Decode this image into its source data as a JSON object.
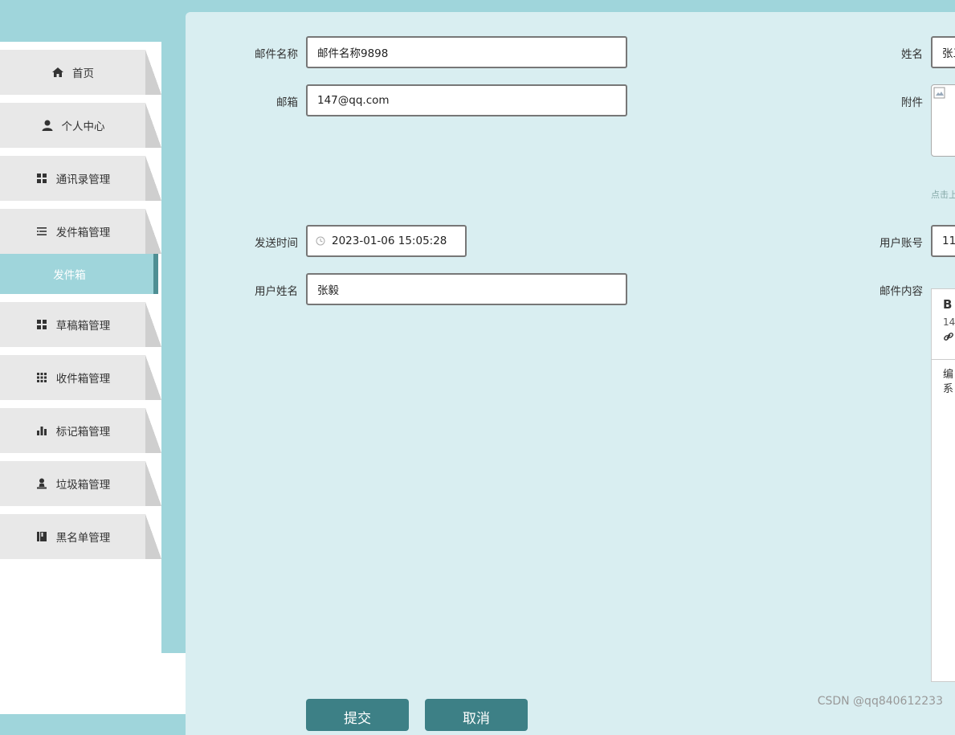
{
  "sidebar": {
    "items": [
      {
        "label": "首页",
        "icon": "home-icon"
      },
      {
        "label": "个人中心",
        "icon": "user-icon"
      },
      {
        "label": "通讯录管理",
        "icon": "grid-icon"
      },
      {
        "label": "发件箱管理",
        "icon": "list-icon"
      },
      {
        "label": "草稿箱管理",
        "icon": "grid-icon"
      },
      {
        "label": "收件箱管理",
        "icon": "apps-icon"
      },
      {
        "label": "标记箱管理",
        "icon": "bar-chart-icon"
      },
      {
        "label": "垃圾箱管理",
        "icon": "person-stand-icon"
      },
      {
        "label": "黑名单管理",
        "icon": "book-icon"
      }
    ],
    "subitem": "发件箱"
  },
  "form": {
    "mail_name": {
      "label": "邮件名称",
      "value": "邮件名称9898"
    },
    "email": {
      "label": "邮箱",
      "value": "147@qq.com"
    },
    "send_time": {
      "label": "发送时间",
      "value": "2023-01-06 15:05:28"
    },
    "user_name": {
      "label": "用户姓名",
      "value": "张毅"
    },
    "name": {
      "label": "姓名",
      "value": "张三"
    },
    "attachment": {
      "label": "附件",
      "hint": "点击上"
    },
    "account": {
      "label": "用户账号",
      "value": "11"
    },
    "content": {
      "label": "邮件内容",
      "toolbar_b": "B",
      "toolbar_size": "14",
      "body_line1": "编",
      "body_line2": "系"
    }
  },
  "buttons": {
    "submit": "提交",
    "cancel": "取消"
  },
  "watermark": "CSDN @qq840612233",
  "colors": {
    "accent": "#3d8086",
    "background": "#9fd5db",
    "panel": "#d9eef1"
  }
}
